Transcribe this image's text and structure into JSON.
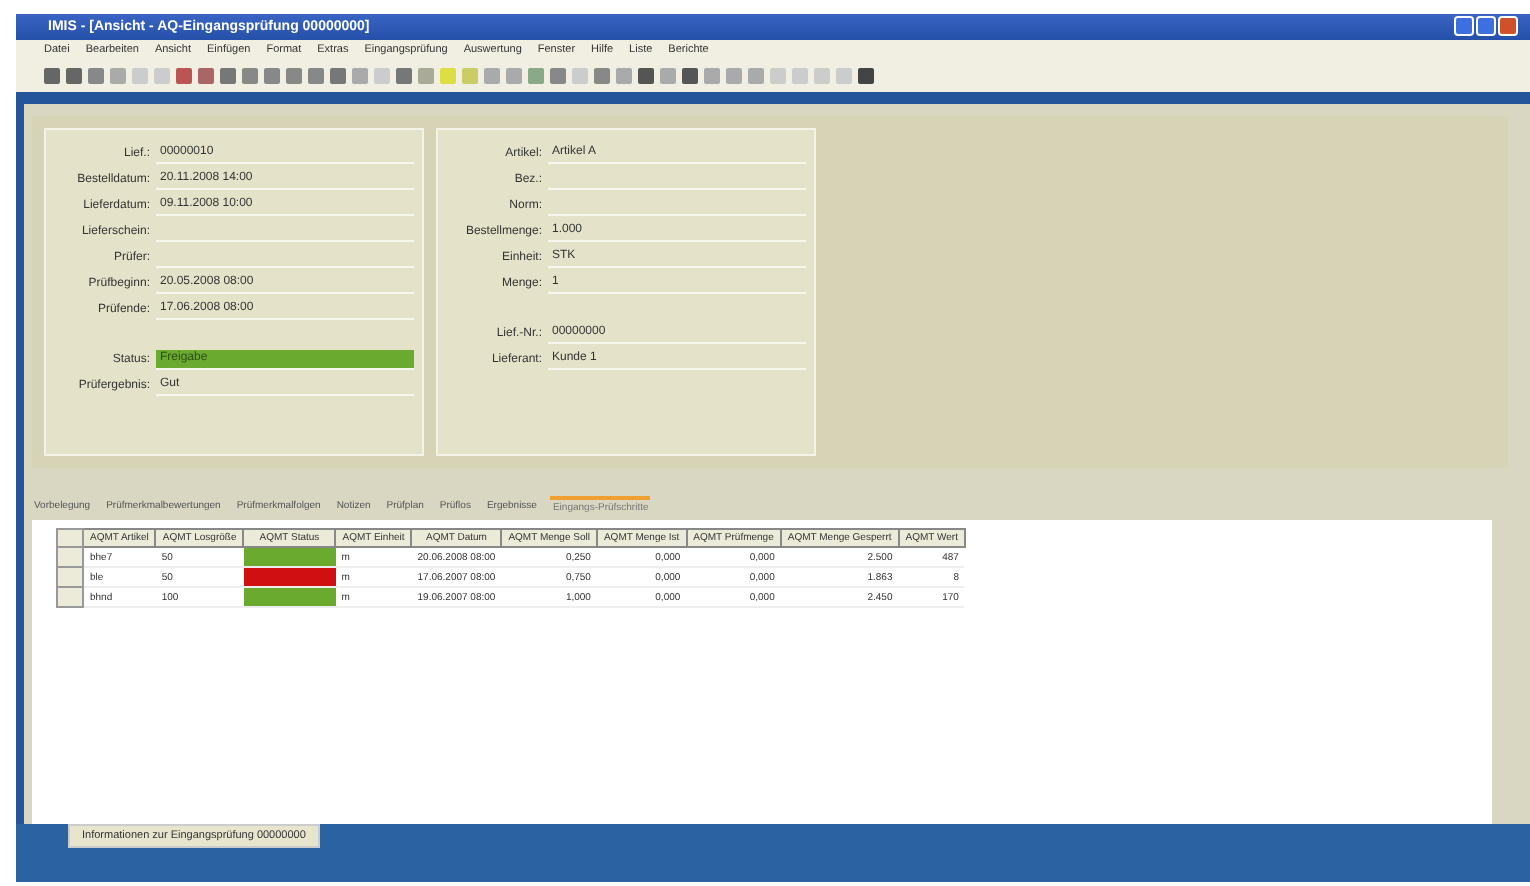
{
  "window": {
    "title": "IMIS - [Ansicht - AQ-Eingangsprüfung 00000000]"
  },
  "menu": [
    "Datei",
    "Bearbeiten",
    "Ansicht",
    "Einfügen",
    "Format",
    "Extras",
    "Eingangsprüfung",
    "Auswertung",
    "Fenster",
    "Hilfe",
    "Liste",
    "Berichte"
  ],
  "left_panel": [
    {
      "label": "Lief.:",
      "value": "00000010"
    },
    {
      "label": "Bestelldatum:",
      "value": "20.11.2008 14:00"
    },
    {
      "label": "Lieferdatum:",
      "value": "09.11.2008 10:00"
    },
    {
      "label": "Lieferschein:"
    },
    {
      "label": "Prüfer:"
    },
    {
      "label": "Prüfbeginn:",
      "value": "20.05.2008 08:00"
    },
    {
      "label": "Prüfende:",
      "value": "17.06.2008 08:00"
    },
    {
      "label": "Status:",
      "value": "Freigabe",
      "color": "#6aaa2e"
    },
    {
      "label": "Prüfergebnis:",
      "value": "Gut"
    }
  ],
  "right_panel": [
    {
      "label": "Artikel:",
      "value": "Artikel A"
    },
    {
      "label": "Bez.:"
    },
    {
      "label": "Norm:"
    },
    {
      "label": "Bestellmenge:",
      "value": "1.000"
    },
    {
      "label": "Einheit:",
      "value": "STK"
    },
    {
      "label": "Menge:",
      "value": "1"
    },
    {
      "label": "Lief.-Nr.:",
      "value": "00000000"
    },
    {
      "label": "Lieferant:",
      "value": "Kunde 1"
    }
  ],
  "tabs": [
    {
      "label": "Vorbelegung",
      "selected": false
    },
    {
      "label": "Prüfmerkmalbewertungen",
      "selected": false
    },
    {
      "label": "Prüfmerkmalfolgen",
      "selected": false
    },
    {
      "label": "Notizen",
      "selected": false
    },
    {
      "label": "Prüfplan",
      "selected": false
    },
    {
      "label": "Prüflos",
      "selected": false
    },
    {
      "label": "Ergebnisse",
      "selected": false
    },
    {
      "label": "Eingangs-Prüfschritte",
      "selected": true
    }
  ],
  "table": {
    "columns": [
      "AQMT Artikel",
      "AQMT Losgröße",
      "AQMT Status",
      "AQMT Einheit",
      "AQMT Datum",
      "AQMT Menge Soll",
      "AQMT Menge Ist",
      "AQMT Prüfmenge",
      "AQMT Menge Gesperrt",
      "AQMT Wert"
    ],
    "rows": [
      {
        "cells": [
          "bhe7",
          "50",
          "",
          "m",
          "20.06.2008 08:00",
          "0,250",
          "0,000",
          "0,000",
          "2.500",
          "487"
        ],
        "color": "#6aaa2e"
      },
      {
        "cells": [
          "ble",
          "50",
          "",
          "m",
          "17.06.2007 08:00",
          "0,750",
          "0,000",
          "0,000",
          "1.863",
          "8"
        ],
        "color": "#d01010"
      },
      {
        "cells": [
          "bhnd",
          "100",
          "",
          "m",
          "19.06.2007 08:00",
          "1,000",
          "0,000",
          "0,000",
          "2.450",
          "170"
        ],
        "color": "#6aaa2e"
      }
    ]
  },
  "taskbar": {
    "item": "Informationen zur Eingangsprüfung 00000000"
  }
}
